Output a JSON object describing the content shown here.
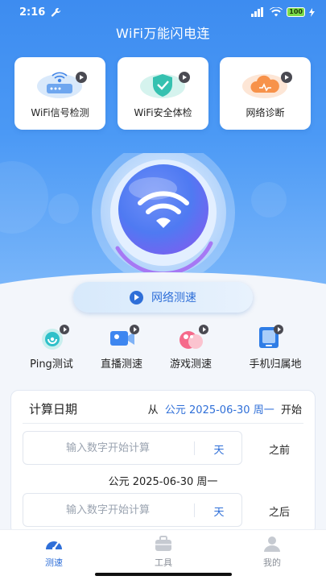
{
  "status_bar": {
    "time": "2:16",
    "battery": "100"
  },
  "app_title": "WiFi万能闪电连",
  "top_cards": [
    {
      "label": "WiFi信号检测",
      "icon": "router-icon"
    },
    {
      "label": "WiFi安全体检",
      "icon": "shield-check-icon"
    },
    {
      "label": "网络诊断",
      "icon": "cloud-icon"
    }
  ],
  "speed_test_button": "网络测速",
  "tools": [
    {
      "label": "Ping测试",
      "icon": "ping-icon"
    },
    {
      "label": "直播测速",
      "icon": "video-camera-icon"
    },
    {
      "label": "游戏测速",
      "icon": "game-icon"
    },
    {
      "label": "手机归属地",
      "icon": "phone-location-icon"
    }
  ],
  "calculator": {
    "title": "计算日期",
    "from_prefix": "从",
    "date": "公元 2025-06-30 周一",
    "start_suffix": "开始",
    "input_placeholder": "输入数字开始计算",
    "unit": "天",
    "before": "之前",
    "after": "之后",
    "middle_date": "公元 2025-06-30 周一"
  },
  "tabbar": [
    {
      "label": "测速",
      "active": true
    },
    {
      "label": "工具",
      "active": false
    },
    {
      "label": "我的",
      "active": false
    }
  ],
  "colors": {
    "accent": "#2f6fd8",
    "hero_top": "#3d8cf0",
    "background": "#f3f6fb"
  }
}
